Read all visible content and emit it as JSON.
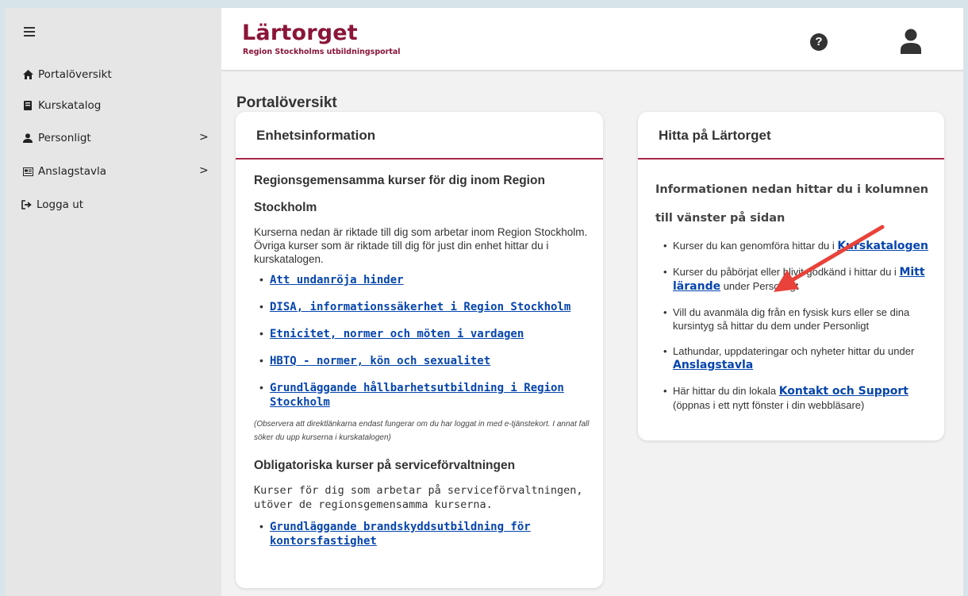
{
  "sidebar": {
    "items": [
      {
        "icon": "home-icon",
        "label": "Portalöversikt"
      },
      {
        "icon": "book-icon",
        "label": "Kurskatalog"
      },
      {
        "icon": "user-icon",
        "label": "Personligt",
        "chevron": ">"
      },
      {
        "icon": "board-icon",
        "label": "Anslagstavla",
        "chevron": ">"
      },
      {
        "icon": "logout-icon",
        "label": "Logga ut"
      }
    ]
  },
  "header": {
    "brand_title": "Lärtorget",
    "brand_subtitle": "Region Stockholms utbildningsportal",
    "help_glyph": "?"
  },
  "page": {
    "title": "Portalöversikt"
  },
  "card_unit": {
    "title": "Enhetsinformation",
    "section1_heading": "Regionsgemensamma kurser för dig inom Region Stockholm",
    "section1_text": "Kurserna nedan är riktade till dig som arbetar inom Region Stockholm. Övriga kurser som är riktade till dig för just din enhet hittar du i kurskatalogen.",
    "links": [
      "Att undanröja hinder",
      "DISA, informationssäkerhet i Region Stockholm",
      "Etnicitet, normer och möten i vardagen",
      "HBTQ - normer, kön och sexualitet",
      "Grundläggande hållbarhetsutbildning i Region Stockholm"
    ],
    "note": "(Observera att direktlänkarna endast fungerar om du har loggat in med e-tjänstekort. I annat fall söker du upp kurserna i kurskatalogen)",
    "section2_heading": "Obligatoriska kurser på serviceförvaltningen",
    "section2_text": "Kurser för dig som arbetar på serviceförvaltningen, utöver de regionsgemensamma kurserna.",
    "section2_link": "Grundläggande brandskyddsutbildning för kontorsfastighet"
  },
  "card_find": {
    "title": "Hitta på Lärtorget",
    "intro": "Informationen nedan hittar du i kolumnen till vänster på sidan",
    "items": [
      {
        "before": "Kurser du kan genomföra hittar du i ",
        "link": "Kurskatalogen",
        "after": ""
      },
      {
        "before": "Kurser du påbörjat eller blivit godkänd i hittar du i ",
        "link": "Mitt lärande",
        "after": " under Personligt"
      },
      {
        "before": "Vill du avanmäla dig från en fysisk kurs eller se dina kursintyg så hittar du dem under Personligt",
        "link": "",
        "after": ""
      },
      {
        "before": "Lathundar, uppdateringar och nyheter hittar du under ",
        "link": "Anslagstavla",
        "after": ""
      },
      {
        "before": "Här hittar du din lokala ",
        "link": "Kontakt och Support",
        "after": " (öppnas i ett nytt fönster i din webbläsare)"
      }
    ]
  },
  "colors": {
    "brand": "#8a1538",
    "accent_line": "#a8284a",
    "link": "#0645ad",
    "annotation_arrow": "#e8423a"
  }
}
